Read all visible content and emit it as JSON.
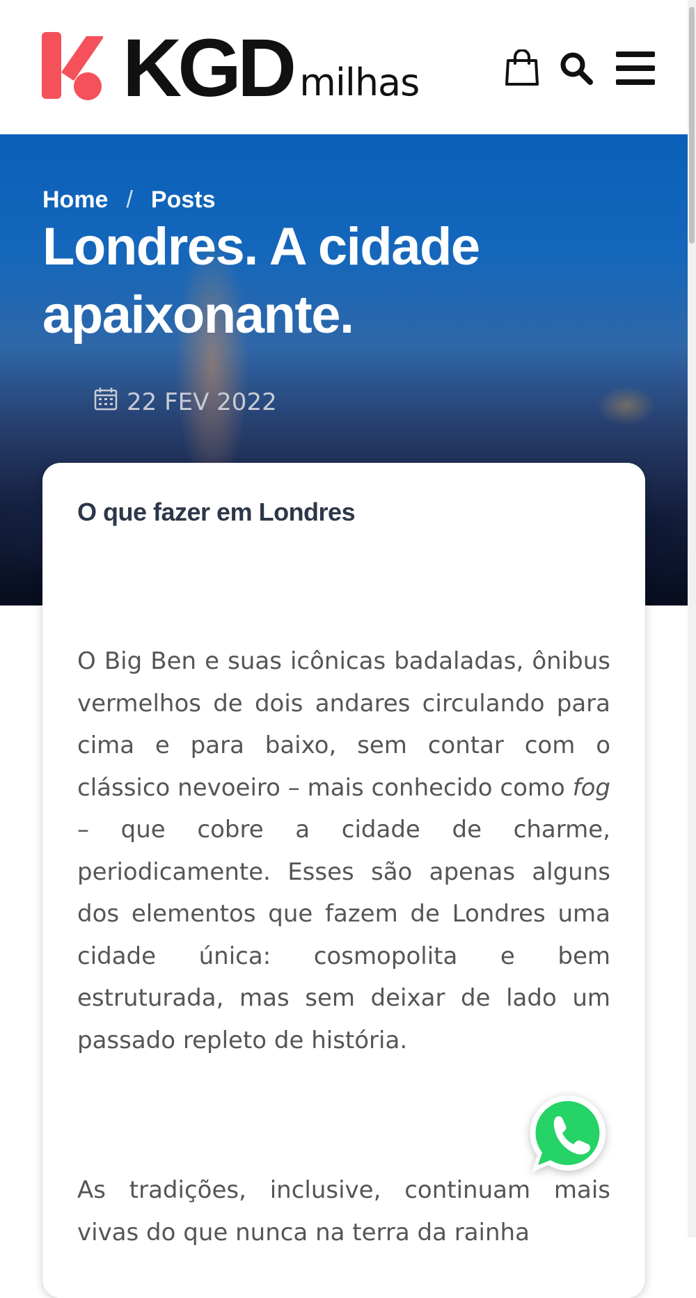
{
  "header": {
    "logo_text": "KGD",
    "logo_sub": "milhas",
    "cart_icon": "shopping-bag-icon",
    "search_icon": "search-icon",
    "menu_icon": "hamburger-menu-icon",
    "brand_color": "#f4515a"
  },
  "breadcrumb": {
    "home": "Home",
    "separator": "/",
    "posts": "Posts"
  },
  "post": {
    "title": "Londres. A cidade apaixonante.",
    "date": "22 FEV 2022",
    "date_icon": "calendar-icon",
    "section_heading": "O que fazer em Londres",
    "paragraph_1_before": "O Big Ben e suas icônicas badaladas, ônibus vermelhos de dois andares circulando para cima e para baixo, sem contar com o clássico nevoeiro – mais conhecido como ",
    "paragraph_1_em": "fog",
    "paragraph_1_after": " – que cobre a cidade de charme, periodicamente. Esses são apenas alguns dos elementos que fazem de Londres uma cidade única: cosmopolita e bem estruturada, mas sem deixar de lado um passado repleto de história.",
    "paragraph_2": "As tradições, inclusive, continuam mais vivas do que nunca na terra da rainha"
  },
  "floating": {
    "whatsapp_icon": "whatsapp-icon",
    "whatsapp_color": "#25d366"
  }
}
